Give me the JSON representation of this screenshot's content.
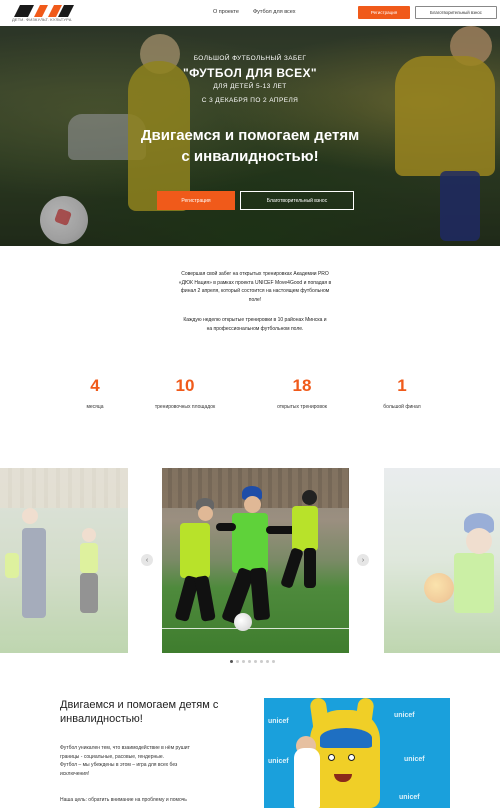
{
  "header": {
    "logo_tagline": "ДЕТИ. ФИЗКУЛЬТ. КУЛЬТУРА",
    "nav": [
      "О проекте",
      "Футбол для всех"
    ],
    "register_label": "Регистрация",
    "charity_label": "Благотворительный взнос",
    "accent_color": "#f05a1a"
  },
  "hero": {
    "pre_title": "БОЛЬШОЙ ФУТБОЛЬНЫЙ ЗАБЕГ",
    "title": "\"ФУТБОЛ ДЛЯ ВСЕХ\"",
    "age": "ДЛЯ ДЕТЕЙ 5-13 ЛЕТ",
    "dates": "С 3 ДЕКАБРЯ ПО 2 АПРЕЛЯ",
    "slogan_line1": "Двигаемся и помогаем детям",
    "slogan_line2": "с инвалидностью!",
    "register_label": "Регистрация",
    "charity_label": "Благотворительный взнос"
  },
  "intro": {
    "p1": [
      "Совершая свой забег на открытых тренировках Академии PRO",
      "«ДЮК Нация» в рамках проекта UNICEF Move4Good и попадая в",
      "финал 2 апреля, который состоится на настоящем футбольном",
      "поле!"
    ],
    "p2": [
      "Каждую неделю открытые тренировки в 10 районах Минска и",
      "на профессиональном футбольном поле."
    ]
  },
  "stats": [
    {
      "value": "4",
      "label": "месяца"
    },
    {
      "value": "10",
      "label": "тренировочных площадок"
    },
    {
      "value": "18",
      "label": "открытых тренировок"
    },
    {
      "value": "1",
      "label": "большой финал"
    }
  ],
  "carousel": {
    "prev_icon": "chevron-left-icon",
    "next_icon": "chevron-right-icon",
    "slides_count": 8,
    "active_index": 0
  },
  "about": {
    "title_line1": "Двигаемся и помогаем детям с",
    "title_line2": "инвалидностью!",
    "p1": [
      "Футбол уникален тем, что взаимодействие в нём рушит",
      "границы - социальные, расовые, гендерные.",
      "Футбол – мы убеждены в этом – игра для всех без",
      "исключения!"
    ],
    "p2": "Наша цель: обратить внимание на проблему и помочь",
    "image_watermark": "unicef"
  }
}
